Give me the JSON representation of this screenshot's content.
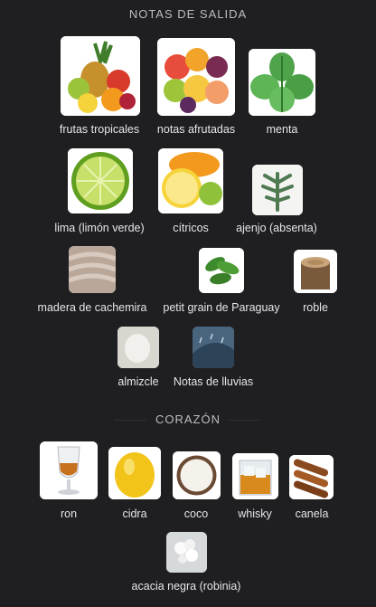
{
  "sections": [
    {
      "title": "NOTAS DE SALIDA",
      "items": [
        {
          "label": "frutas tropicales",
          "icon": "tropical-fruits"
        },
        {
          "label": "notas afrutadas",
          "icon": "fruity-notes"
        },
        {
          "label": "menta",
          "icon": "mint"
        },
        {
          "label": "lima (limón verde)",
          "icon": "lime"
        },
        {
          "label": "cítricos",
          "icon": "citrus"
        },
        {
          "label": "ajenjo (absenta)",
          "icon": "wormwood"
        },
        {
          "label": "madera de cachemira",
          "icon": "cashmere-wood"
        },
        {
          "label": "petit grain de Paraguay",
          "icon": "petitgrain"
        },
        {
          "label": "roble",
          "icon": "oak"
        },
        {
          "label": "almizcle",
          "icon": "musk"
        },
        {
          "label": "Notas de lluvias",
          "icon": "rain"
        }
      ]
    },
    {
      "title": "CORAZÓN",
      "items": [
        {
          "label": "ron",
          "icon": "rum"
        },
        {
          "label": "cidra",
          "icon": "citron"
        },
        {
          "label": "coco",
          "icon": "coconut"
        },
        {
          "label": "whisky",
          "icon": "whisky"
        },
        {
          "label": "canela",
          "icon": "cinnamon"
        },
        {
          "label": "acacia negra (robinia)",
          "icon": "robinia"
        }
      ]
    }
  ]
}
